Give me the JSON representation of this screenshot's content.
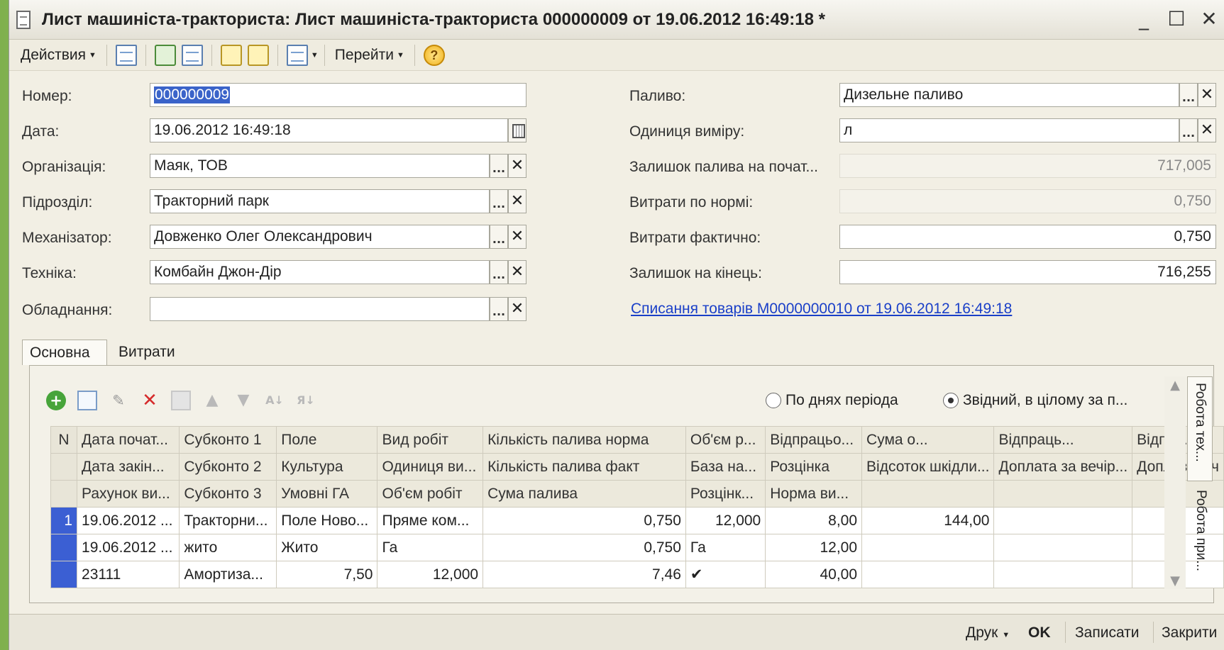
{
  "window": {
    "title": "Лист машиніста-тракториста: Лист машиніста-тракториста 000000009 от 19.06.2012 16:49:18 *",
    "controls": {
      "minimize": "_",
      "maximize": "☐",
      "close": "✕"
    }
  },
  "toolbar": {
    "actions_label": "Действия",
    "goto_label": "Перейти",
    "help_label": "?"
  },
  "form": {
    "number_label": "Номер:",
    "number_value": "000000009",
    "date_label": "Дата:",
    "date_value": "19.06.2012 16:49:18",
    "org_label": "Організація:",
    "org_value": "Маяк, ТОВ",
    "dept_label": "Підрозділ:",
    "dept_value": "Тракторний парк",
    "operator_label": "Механізатор:",
    "operator_value": "Довженко  Олег Олександрович",
    "tech_label": "Техніка:",
    "tech_value": "Комбайн Джон-Дір",
    "equip_label": "Обладнання:",
    "equip_value": "",
    "fuel_label": "Паливо:",
    "fuel_value": "Дизельне паливо",
    "unit_label": "Одиниця виміру:",
    "unit_value": "л",
    "fuel_start_label": "Залишок палива на почат...",
    "fuel_start_value": "717,005",
    "norm_label": "Витрати по нормі:",
    "norm_value": "0,750",
    "actual_label": "Витрати фактично:",
    "actual_value": "0,750",
    "end_label": "Залишок на кінець:",
    "end_value": "716,255",
    "writeoff_link": "Списання товарів М0000000010 от 19.06.2012 16:49:18",
    "dots": "...",
    "clear": "✕"
  },
  "tabs": {
    "main": "Основна",
    "costs": "Витрати"
  },
  "side_tabs": {
    "tech_work": "Робота тех...",
    "attach_work": "Робота при..."
  },
  "grid_toolbar": {
    "radio_by_days": "По днях періода",
    "radio_summary": "Звідний, в цілому за п..."
  },
  "table": {
    "header_rows": [
      [
        "N",
        "Дата почат...",
        "Субконто 1",
        "Поле",
        "Вид робіт",
        "Кількість палива норма",
        "Об'єм р...",
        "Відпрацьо...",
        "Сума о...",
        "Відпраць...",
        "Відпр..."
      ],
      [
        "",
        "Дата закін...",
        "Субконто 2",
        "Культура",
        "Одиниця ви...",
        "Кількість палива факт",
        "База на...",
        "Розцінка",
        "Відсоток шкідли...",
        "Доплата за вечір...",
        "Допл. за ніч"
      ],
      [
        "",
        "Рахунок ви...",
        "Субконто 3",
        "Умовні ГА",
        "Об'єм робіт",
        "Сума палива",
        "Розцінк...",
        "Норма ви...",
        "",
        "",
        ""
      ]
    ],
    "rows": [
      [
        "1",
        "19.06.2012 ...",
        "Тракторни...",
        "Поле Ново...",
        "Пряме ком...",
        "0,750",
        "12,000",
        "8,00",
        "144,00",
        "",
        ""
      ],
      [
        "",
        "19.06.2012 ...",
        "жито",
        "Жито",
        "Га",
        "0,750",
        "Га",
        "12,00",
        "",
        "",
        ""
      ],
      [
        "",
        "23111",
        "Амортиза...",
        "7,50",
        "12,000",
        "7,46",
        "✔",
        "40,00",
        "",
        "",
        ""
      ]
    ]
  },
  "statusbar": {
    "print_label": "Друк",
    "ok_label": "OK",
    "save_label": "Записати",
    "close_label": "Закрити"
  }
}
